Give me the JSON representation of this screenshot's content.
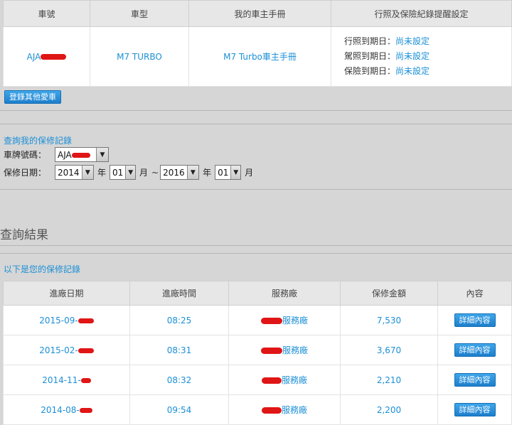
{
  "vehicle_table": {
    "headers": [
      "車號",
      "車型",
      "我的車主手冊",
      "行照及保險紀錄提醒設定"
    ],
    "row": {
      "plate_prefix": "AJA",
      "model": "M7 TURBO",
      "manual_link": "M7 Turbo車主手冊",
      "reminders": [
        {
          "label": "行照到期日：",
          "value": "尚未設定"
        },
        {
          "label": "駕照到期日：",
          "value": "尚未設定"
        },
        {
          "label": "保險到期日：",
          "value": "尚未設定"
        }
      ]
    }
  },
  "register_button": "登錄其他愛車",
  "search": {
    "title": "查詢我的保修記錄",
    "plate_label": "車牌號碼：",
    "plate_value": "AJA",
    "date_label": "保修日期：",
    "from_year": "2014",
    "year_unit": "年",
    "from_month": "01",
    "month_unit": "月",
    "range_sep": "~",
    "to_year": "2016",
    "to_month": "01"
  },
  "results_heading": "查詢結果",
  "records_title": "以下是您的保修記錄",
  "records_table": {
    "headers": [
      "進廠日期",
      "進廠時間",
      "服務廠",
      "保修金額",
      "內容"
    ],
    "rows": [
      {
        "date": "2015-09-",
        "time": "08:25",
        "shop": "服務廠",
        "amount": "7,530",
        "detail": "詳細內容"
      },
      {
        "date": "2015-02-",
        "time": "08:31",
        "shop": "服務廠",
        "amount": "3,670",
        "detail": "詳細內容"
      },
      {
        "date": "2014-11-",
        "time": "08:32",
        "shop": "服務廠",
        "amount": "2,210",
        "detail": "詳細內容"
      },
      {
        "date": "2014-08-",
        "time": "09:54",
        "shop": "服務廠",
        "amount": "2,200",
        "detail": "詳細內容"
      }
    ]
  }
}
